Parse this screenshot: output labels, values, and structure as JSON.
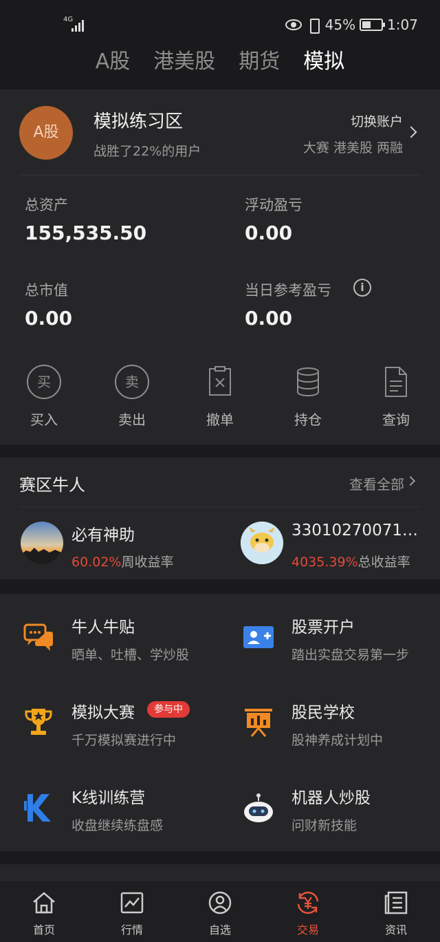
{
  "status_bar": {
    "network": "4G",
    "battery": "45%",
    "time": "1:07"
  },
  "top_tabs": [
    {
      "label": "A股"
    },
    {
      "label": "港美股"
    },
    {
      "label": "期货"
    },
    {
      "label": "模拟",
      "active": true
    }
  ],
  "account": {
    "avatar_text": "A股",
    "title": "模拟练习区",
    "subtitle": "战胜了22%的用户",
    "switch_label": "切换账户",
    "switch_options": "大赛 港美股 两融"
  },
  "metrics": {
    "total_assets_label": "总资产",
    "total_assets_value": "155,535.50",
    "floating_pl_label": "浮动盈亏",
    "floating_pl_value": "0.00",
    "market_value_label": "总市值",
    "market_value_value": "0.00",
    "daily_pl_label": "当日参考盈亏",
    "daily_pl_value": "0.00"
  },
  "actions": [
    {
      "label": "买入",
      "icon_text": "买"
    },
    {
      "label": "卖出",
      "icon_text": "卖"
    },
    {
      "label": "撤单"
    },
    {
      "label": "持仓"
    },
    {
      "label": "查询"
    }
  ],
  "top_traders": {
    "title": "赛区牛人",
    "see_all": "查看全部",
    "items": [
      {
        "name": "必有神助",
        "pct": "60.02%",
        "metric": "周收益率"
      },
      {
        "name": "330102700713...",
        "pct": "4035.39%",
        "metric": "总收益率"
      }
    ]
  },
  "features": [
    {
      "title": "牛人牛贴",
      "subtitle": "晒单、吐槽、学炒股"
    },
    {
      "title": "股票开户",
      "subtitle": "踏出实盘交易第一步"
    },
    {
      "title": "模拟大赛",
      "subtitle": "千万模拟赛进行中",
      "badge": "参与中"
    },
    {
      "title": "股民学校",
      "subtitle": "股神养成计划中"
    },
    {
      "title": "K线训练营",
      "subtitle": "收盘继续练盘感"
    },
    {
      "title": "机器人炒股",
      "subtitle": "问财新技能"
    }
  ],
  "bottom_nav": [
    {
      "label": "首页"
    },
    {
      "label": "行情"
    },
    {
      "label": "自选"
    },
    {
      "label": "交易",
      "active": true
    },
    {
      "label": "资讯"
    }
  ],
  "colors": {
    "accent_red": "#e24b3b",
    "avatar_orange": "#b8642f"
  }
}
